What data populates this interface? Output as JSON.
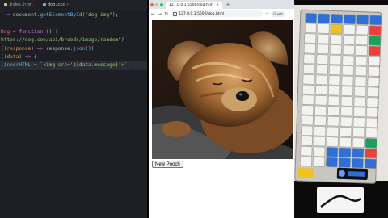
{
  "editor": {
    "tabs": [
      {
        "label": "index.html"
      },
      {
        "label": "dog.css"
      }
    ],
    "lines": [
      {
        "parts": [
          [
            "",
            "  "
          ],
          [
            "c-kw",
            "= "
          ],
          [
            "c-pun",
            "document."
          ],
          [
            "c-fn",
            "getElementById"
          ],
          [
            "c-pun",
            "("
          ],
          [
            "c-str",
            "\"dog-img\""
          ],
          [
            "c-pun",
            ");"
          ]
        ]
      },
      {
        "parts": []
      },
      {
        "parts": [
          [
            "c-var",
            "Dog"
          ],
          [
            "c-pun",
            " = "
          ],
          [
            "c-kw",
            "function"
          ],
          [
            "c-pun",
            " () {"
          ]
        ]
      },
      {
        "parts": [
          [
            "c-str",
            "https://dog.ceo/api/breeds/image/random"
          ],
          [
            "c-pun",
            "\")"
          ]
        ]
      },
      {
        "parts": [
          [
            "c-pun",
            "(("
          ],
          [
            "c-arg",
            "response"
          ],
          [
            "c-pun",
            ") "
          ],
          [
            "c-kw",
            "=>"
          ],
          [
            "c-pun",
            " response."
          ],
          [
            "c-fn",
            "json"
          ],
          [
            "c-pun",
            "())"
          ]
        ]
      },
      {
        "parts": [
          [
            "c-pun",
            "(("
          ],
          [
            "c-arg",
            "data"
          ],
          [
            "c-pun",
            ") "
          ],
          [
            "c-kw",
            "=>"
          ],
          [
            "c-pun",
            " {"
          ]
        ]
      },
      {
        "parts": [
          [
            "c-prop",
            ".innerHTML"
          ],
          [
            "c-pun",
            " = "
          ],
          [
            "c-tpl",
            "`<img src='${data.message}'>`"
          ],
          [
            "c-pun",
            ";"
          ]
        ]
      }
    ]
  },
  "browser": {
    "tab_title": "127.0.0.1:5500/dog.html",
    "url": "127.0.0.1:5500/dog.html",
    "profile_label": "Guest",
    "button_label": "New Pooch"
  },
  "colors": {
    "editor_bg": "#1e1f22",
    "browser_chrome": "#dee1e6",
    "key_white": "#f2f2f0",
    "key_blue": "#2f6fd6",
    "key_yellow": "#f1c21b",
    "key_red": "#e8413b",
    "key_green": "#1aa05a"
  }
}
